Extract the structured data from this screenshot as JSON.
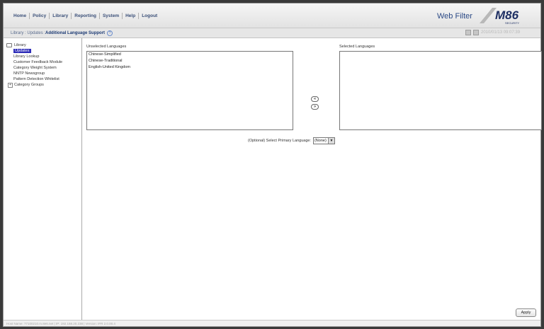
{
  "menu": {
    "items": [
      "Home",
      "Policy",
      "Library",
      "Reporting",
      "System",
      "Help",
      "Logout"
    ]
  },
  "header": {
    "product_name": "Web Filter",
    "logo_text": "M86",
    "logo_subtext": "SECURITY",
    "timestamp": "2010/01/13 09:07:39"
  },
  "breadcrumb": {
    "path": "Library : Updates : ",
    "current": "Additional Language Support"
  },
  "sidebar": {
    "root": "Library",
    "items": [
      "Updates",
      "Library Lookup",
      "Customer Feedback Module",
      "Category Weight System",
      "NNTP Newsgroup",
      "Pattern Detection Whitelist"
    ],
    "group": "Category Groups"
  },
  "unselected": {
    "label": "Unselected Languages",
    "options": [
      "Chinese-Simplified",
      "Chinese-Traditional",
      "English-United Kingdom"
    ]
  },
  "selected": {
    "label": "Selected Languages",
    "options": []
  },
  "move": {
    "left": "«",
    "right": "»"
  },
  "primary": {
    "label": "(Optional) Select Primary Language:",
    "value": "(None)"
  },
  "apply_label": "Apply",
  "status": {
    "text": "Host Name: 77100210.m.8e6.net  |  IP: 192.168.20.238  |  Version: IFR 2.0.00.4"
  },
  "colors": {
    "selection": "#2e2db8",
    "brand": "#2c4a86"
  }
}
